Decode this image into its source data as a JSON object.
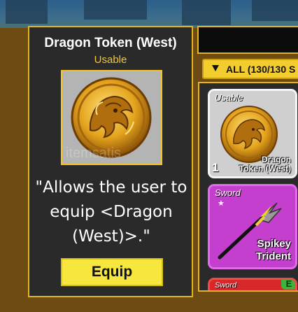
{
  "detail": {
    "title": "Dragon Token (West)",
    "subtitle": "Usable",
    "image_icon": "dragon-token-coin-icon",
    "description": "\"Allows the user to equip <Dragon (West)>.\"",
    "equip_label": "Equip"
  },
  "inventory": {
    "filter_label": "ALL (130/130 S",
    "items": [
      {
        "tag": "Usable",
        "name_line1": "Dragon",
        "name_line2": "Token (West)",
        "quantity": "1",
        "icon": "dragon-token-coin-icon"
      },
      {
        "tag": "Sword",
        "star": "★",
        "name_line1": "Spikey",
        "name_line2": "Trident",
        "icon": "trident-icon"
      },
      {
        "tag": "Sword",
        "badge": "E"
      }
    ]
  },
  "watermark": "itemsatis",
  "colors": {
    "panel_border": "#e5b51e",
    "panel_bg": "#2a2a2a",
    "equip_button": "#f6e63d",
    "usable_text": "#f0c63a",
    "sword_card": "#c53fcf",
    "third_card": "#d8282a",
    "equipped_badge": "#3fb23b"
  }
}
